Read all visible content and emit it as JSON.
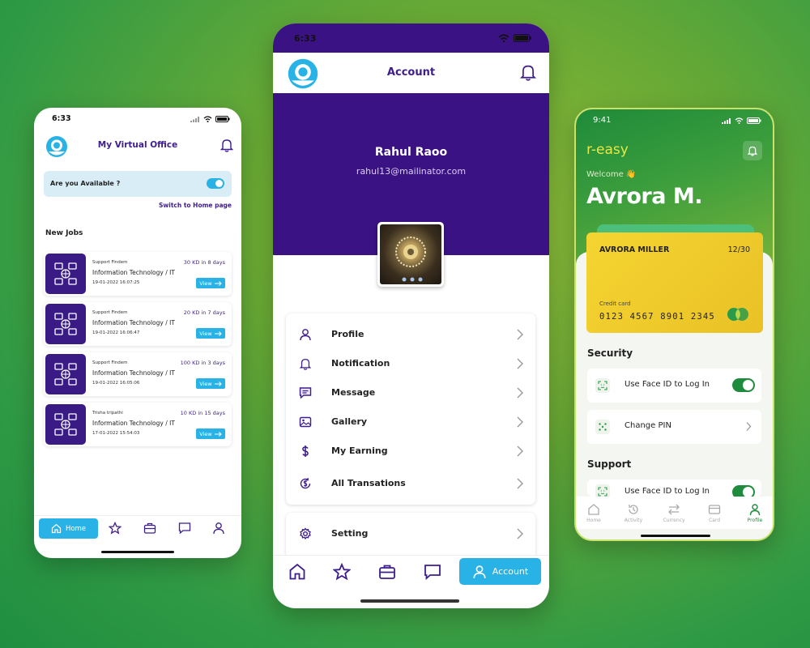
{
  "left_phone": {
    "status_time": "6:33",
    "title": "My Virtual Office",
    "availability_label": "Are you Available ?",
    "switch_home_link": "Switch to Home page",
    "section_title": "New Jobs",
    "jobs": [
      {
        "posted_by": "Support Findem",
        "pay": "30 KD in 8 days",
        "category": "Information Technology / IT",
        "date": "19-01-2022 16:07:25",
        "view_label": "View"
      },
      {
        "posted_by": "Support Findem",
        "pay": "20 KD in 7 days",
        "category": "Information Technology / IT",
        "date": "19-01-2022 16:06:47",
        "view_label": "View"
      },
      {
        "posted_by": "Support Findem",
        "pay": "100 KD in 3 days",
        "category": "Information Technology / IT",
        "date": "19-01-2022 16:05:06",
        "view_label": "View"
      },
      {
        "posted_by": "Trisha tripathi",
        "pay": "10 KD in 15 days",
        "category": "Information Technology / IT",
        "date": "17-01-2022 15:54:03",
        "view_label": "View"
      }
    ],
    "nav_home_label": "Home"
  },
  "center_phone": {
    "status_time": "6:33",
    "title": "Account",
    "user_name": "Rahul Raoo",
    "user_email": "rahul13@mailinator.com",
    "menu_items": [
      {
        "label": "Profile",
        "icon": "user-icon"
      },
      {
        "label": "Notification",
        "icon": "bell-icon"
      },
      {
        "label": "Message",
        "icon": "message-icon"
      },
      {
        "label": "Gallery",
        "icon": "gallery-icon"
      },
      {
        "label": "My Earning",
        "icon": "dollar-icon"
      },
      {
        "label": "All Transations",
        "icon": "transactions-icon"
      }
    ],
    "setting_label": "Setting",
    "nav_account_label": "Account"
  },
  "right_phone": {
    "status_time": "9:41",
    "brand": "r-easy",
    "welcome": "Welcome 👋",
    "user_name": "Avrora M.",
    "card": {
      "holder": "AVRORA MILLER",
      "expiry": "12/30",
      "type": "Credit card",
      "number": "0123 4567 8901 2345"
    },
    "security_title": "Security",
    "security_items": [
      {
        "label": "Use Face ID to Log In"
      },
      {
        "label": "Change PIN"
      }
    ],
    "support_title": "Support",
    "support_items": [
      {
        "label": "Use Face ID to Log In"
      }
    ],
    "tabs": [
      "Home",
      "Activity",
      "Currency",
      "Card",
      "Profile"
    ],
    "active_tab": "Profile"
  },
  "colors": {
    "purple": "#3b1283",
    "accent_blue": "#29b2e6",
    "brand_green": "#1f8b3c",
    "card_yellow": "#f5d531"
  }
}
